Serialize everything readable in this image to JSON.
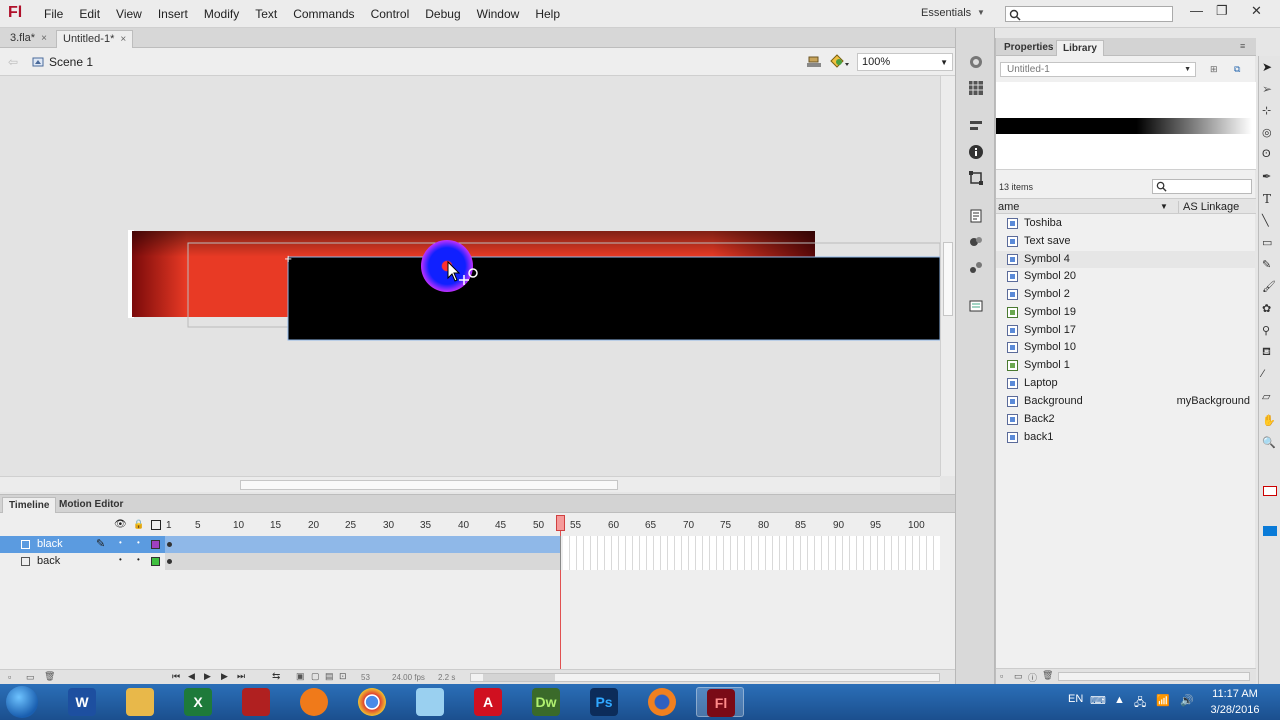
{
  "app": {
    "logo": "Fl"
  },
  "menu": [
    "File",
    "Edit",
    "View",
    "Insert",
    "Modify",
    "Text",
    "Commands",
    "Control",
    "Debug",
    "Window",
    "Help"
  ],
  "workspace": "Essentials",
  "window_controls": {
    "minimize": "—",
    "restore": "❐",
    "close": "✕"
  },
  "doc_tabs": [
    {
      "label": "3.fla*",
      "close": "×"
    },
    {
      "label": "Untitled-1*",
      "close": "×"
    }
  ],
  "edit_bar": {
    "back": "⇦",
    "scene": "Scene 1",
    "zoom": "100%"
  },
  "timeline": {
    "tabs": [
      "Timeline",
      "Motion Editor"
    ],
    "ruler": [
      "1",
      "5",
      "10",
      "15",
      "20",
      "25",
      "30",
      "35",
      "40",
      "45",
      "50",
      "55",
      "60",
      "65",
      "70",
      "75",
      "80",
      "85",
      "90",
      "95",
      "100"
    ],
    "layers": [
      {
        "name": "black",
        "selected": true,
        "color": "#a040c0"
      },
      {
        "name": "back",
        "selected": false,
        "color": "#40c040"
      }
    ],
    "status": {
      "frame": "53",
      "fps": "24.00 fps",
      "time": "2.2 s"
    }
  },
  "panel": {
    "tabs": [
      "Properties",
      "Library"
    ],
    "document": "Untitled-1",
    "item_count": "13 items",
    "col_name": "ame",
    "col_linkage": "AS Linkage",
    "items": [
      {
        "name": "Toshiba",
        "type": "symbol",
        "linkage": ""
      },
      {
        "name": "Text save",
        "type": "symbol",
        "linkage": ""
      },
      {
        "name": "Symbol 4",
        "type": "symbol",
        "linkage": "",
        "selected": true
      },
      {
        "name": "Symbol 20",
        "type": "symbol",
        "linkage": ""
      },
      {
        "name": "Symbol 2",
        "type": "symbol",
        "linkage": ""
      },
      {
        "name": "Symbol 19",
        "type": "bitmap",
        "linkage": ""
      },
      {
        "name": "Symbol 17",
        "type": "symbol",
        "linkage": ""
      },
      {
        "name": "Symbol 10",
        "type": "symbol",
        "linkage": ""
      },
      {
        "name": "Symbol 1",
        "type": "bitmap",
        "linkage": ""
      },
      {
        "name": "Laptop",
        "type": "symbol",
        "linkage": ""
      },
      {
        "name": "Background",
        "type": "symbol",
        "linkage": "myBackground"
      },
      {
        "name": "Back2",
        "type": "symbol",
        "linkage": ""
      },
      {
        "name": "back1",
        "type": "symbol",
        "linkage": ""
      }
    ]
  },
  "taskbar": {
    "apps": [
      "word-icon",
      "explorer-icon",
      "excel-icon",
      "book-icon",
      "media-player-icon",
      "chrome-icon",
      "notepad-icon",
      "acrobat-icon",
      "dreamweaver-icon",
      "photoshop-icon",
      "firefox-icon",
      "flash-icon"
    ],
    "labels": {
      "word": "W",
      "excel": "X",
      "acrobat": "A",
      "dreamweaver": "Dw",
      "photoshop": "Ps",
      "flash": "Fl"
    },
    "lang": "EN",
    "time": "11:17 AM",
    "date": "3/28/2016"
  }
}
